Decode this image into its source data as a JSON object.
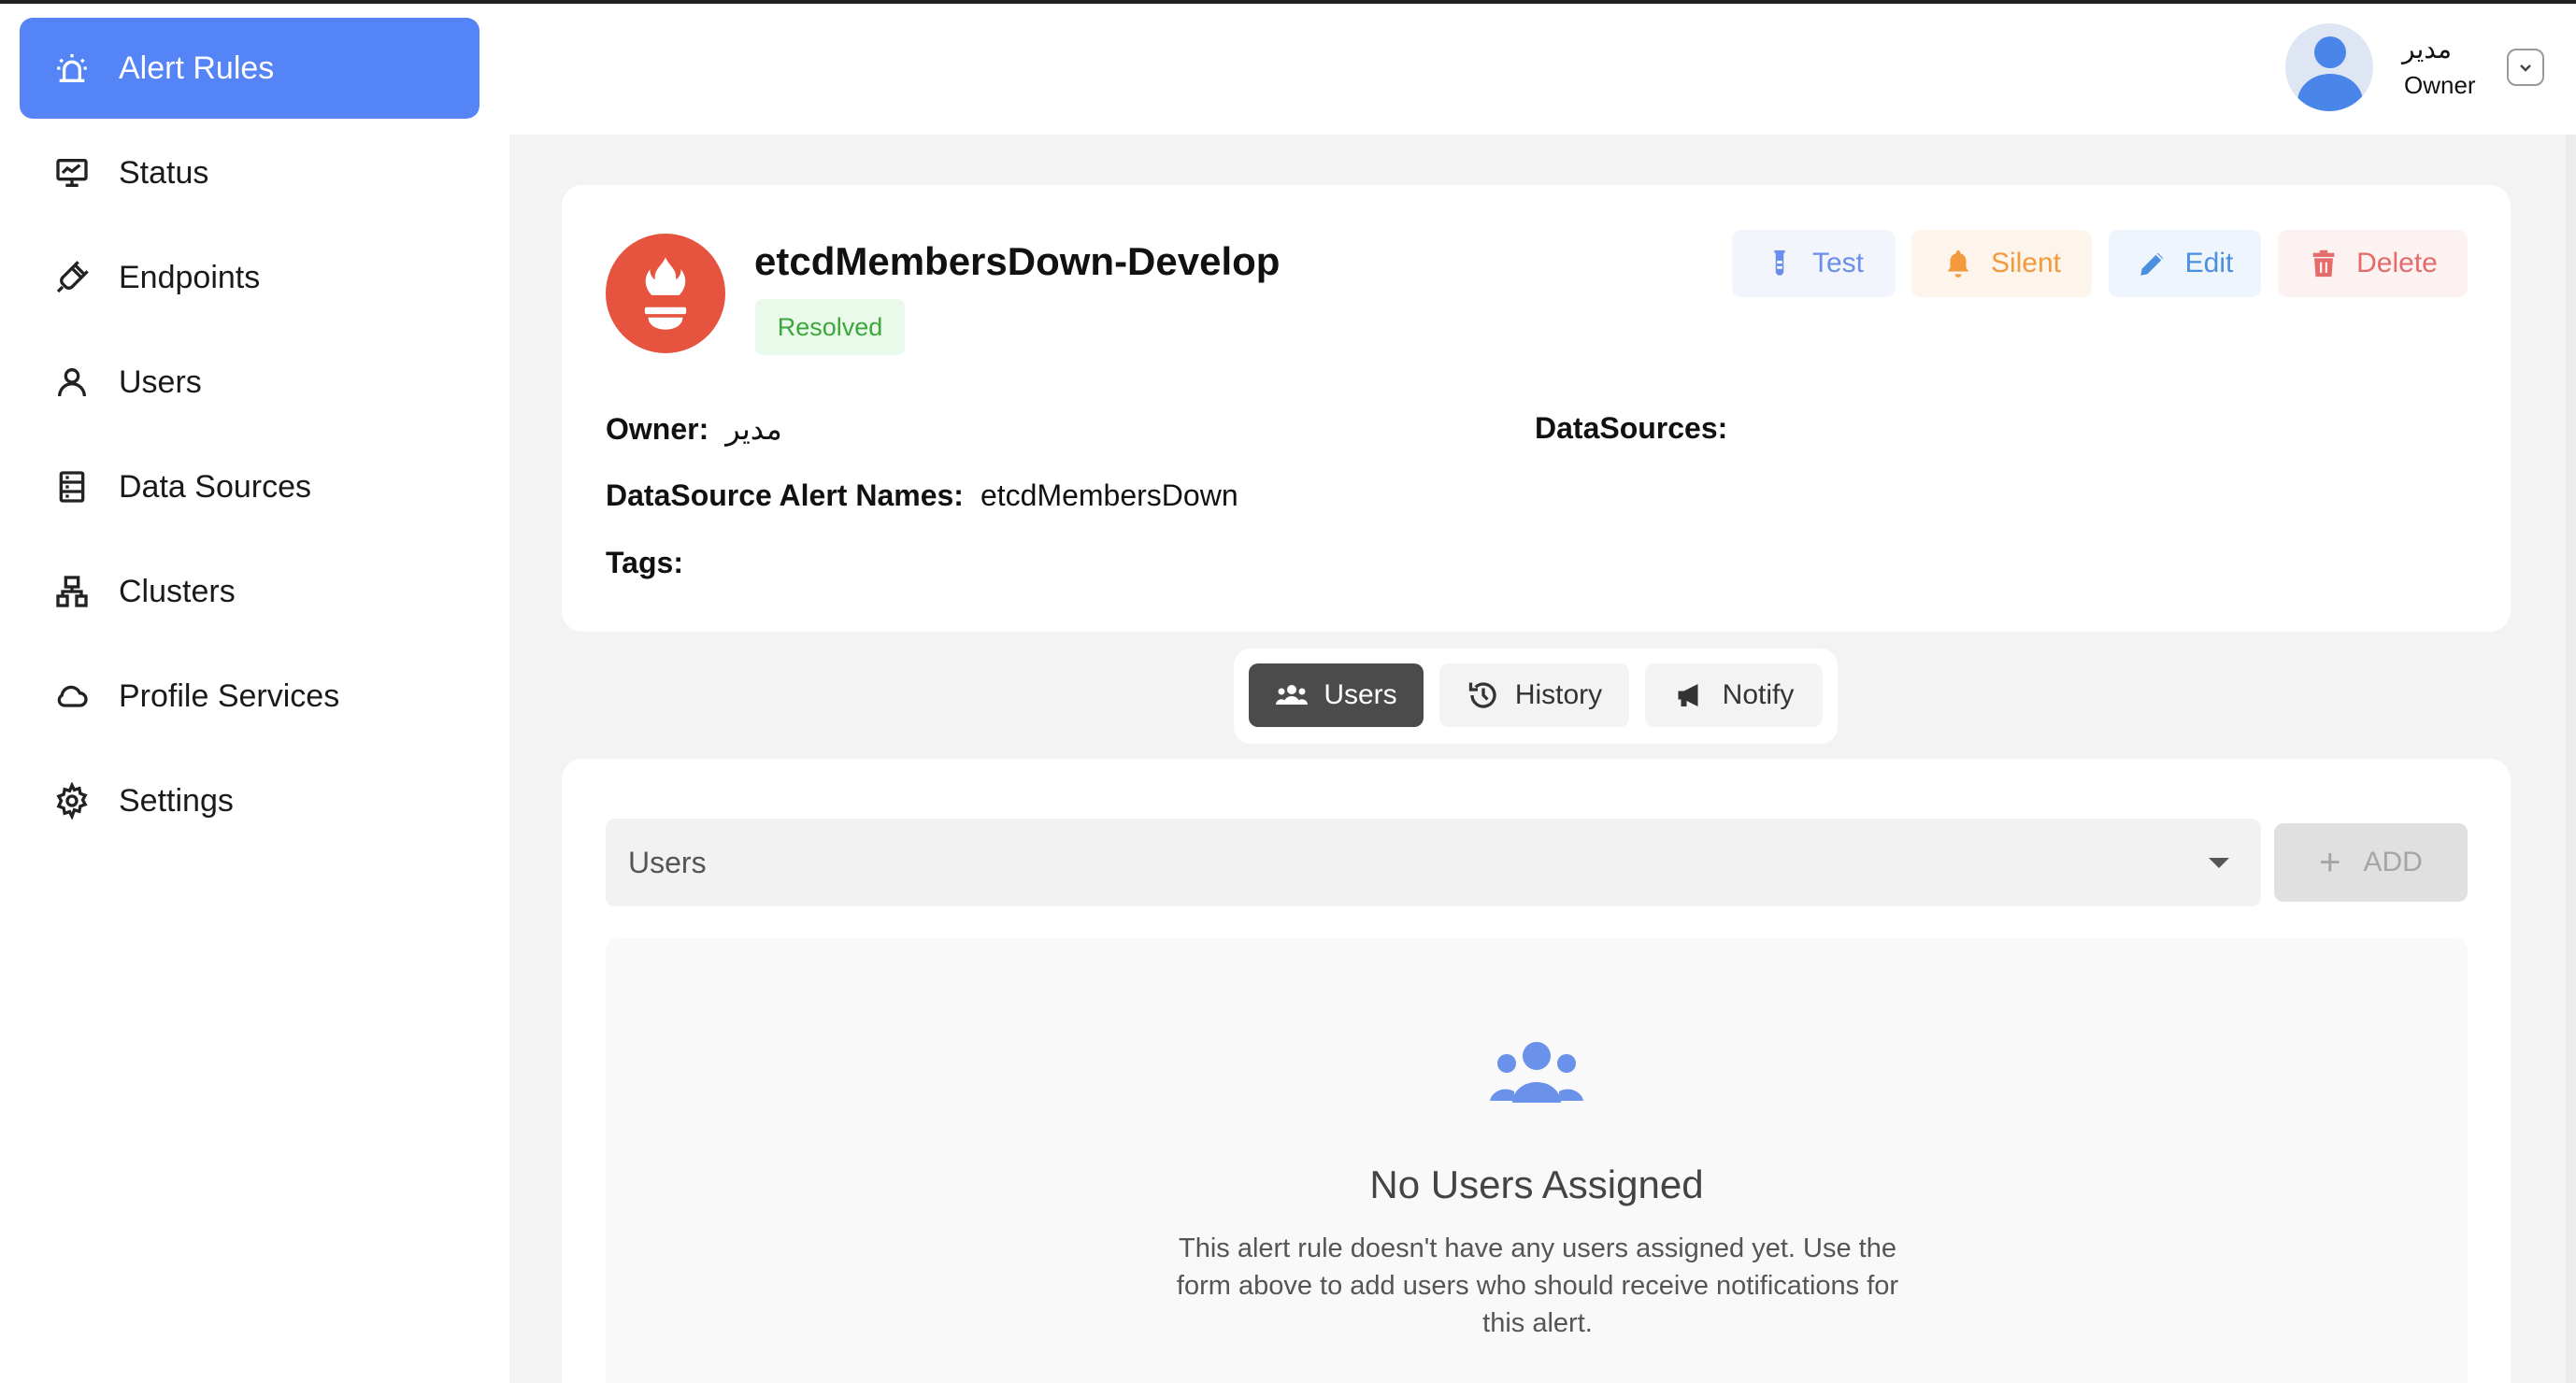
{
  "sidebar": {
    "items": [
      {
        "label": "Alert Rules",
        "icon": "alarm-icon",
        "active": true
      },
      {
        "label": "Status",
        "icon": "monitor-chart-icon"
      },
      {
        "label": "Endpoints",
        "icon": "plug-icon"
      },
      {
        "label": "Users",
        "icon": "user-icon"
      },
      {
        "label": "Data Sources",
        "icon": "server-icon"
      },
      {
        "label": "Clusters",
        "icon": "cluster-icon"
      },
      {
        "label": "Profile Services",
        "icon": "cloud-icon"
      },
      {
        "label": "Settings",
        "icon": "gear-icon"
      }
    ]
  },
  "header": {
    "user_name": "مدير",
    "user_role": "Owner"
  },
  "rule": {
    "title": "etcdMembersDown-Develop",
    "status": "Resolved",
    "owner_label": "Owner:",
    "owner_value": "مدير",
    "datasources_label": "DataSources:",
    "alert_names_label": "DataSource Alert Names:",
    "alert_names_value": "etcdMembersDown",
    "tags_label": "Tags:"
  },
  "actions": {
    "test": "Test",
    "silent": "Silent",
    "edit": "Edit",
    "delete": "Delete"
  },
  "tabs": {
    "users": "Users",
    "history": "History",
    "notify": "Notify"
  },
  "users_panel": {
    "select_value": "Users",
    "add_label": "ADD",
    "empty_title": "No Users Assigned",
    "empty_desc": "This alert rule doesn't have any users assigned yet. Use the form above to add users who should receive notifications for this alert."
  },
  "colors": {
    "accent": "#5484f5",
    "resolved": "#3aa83a",
    "logo": "#e6533f"
  }
}
